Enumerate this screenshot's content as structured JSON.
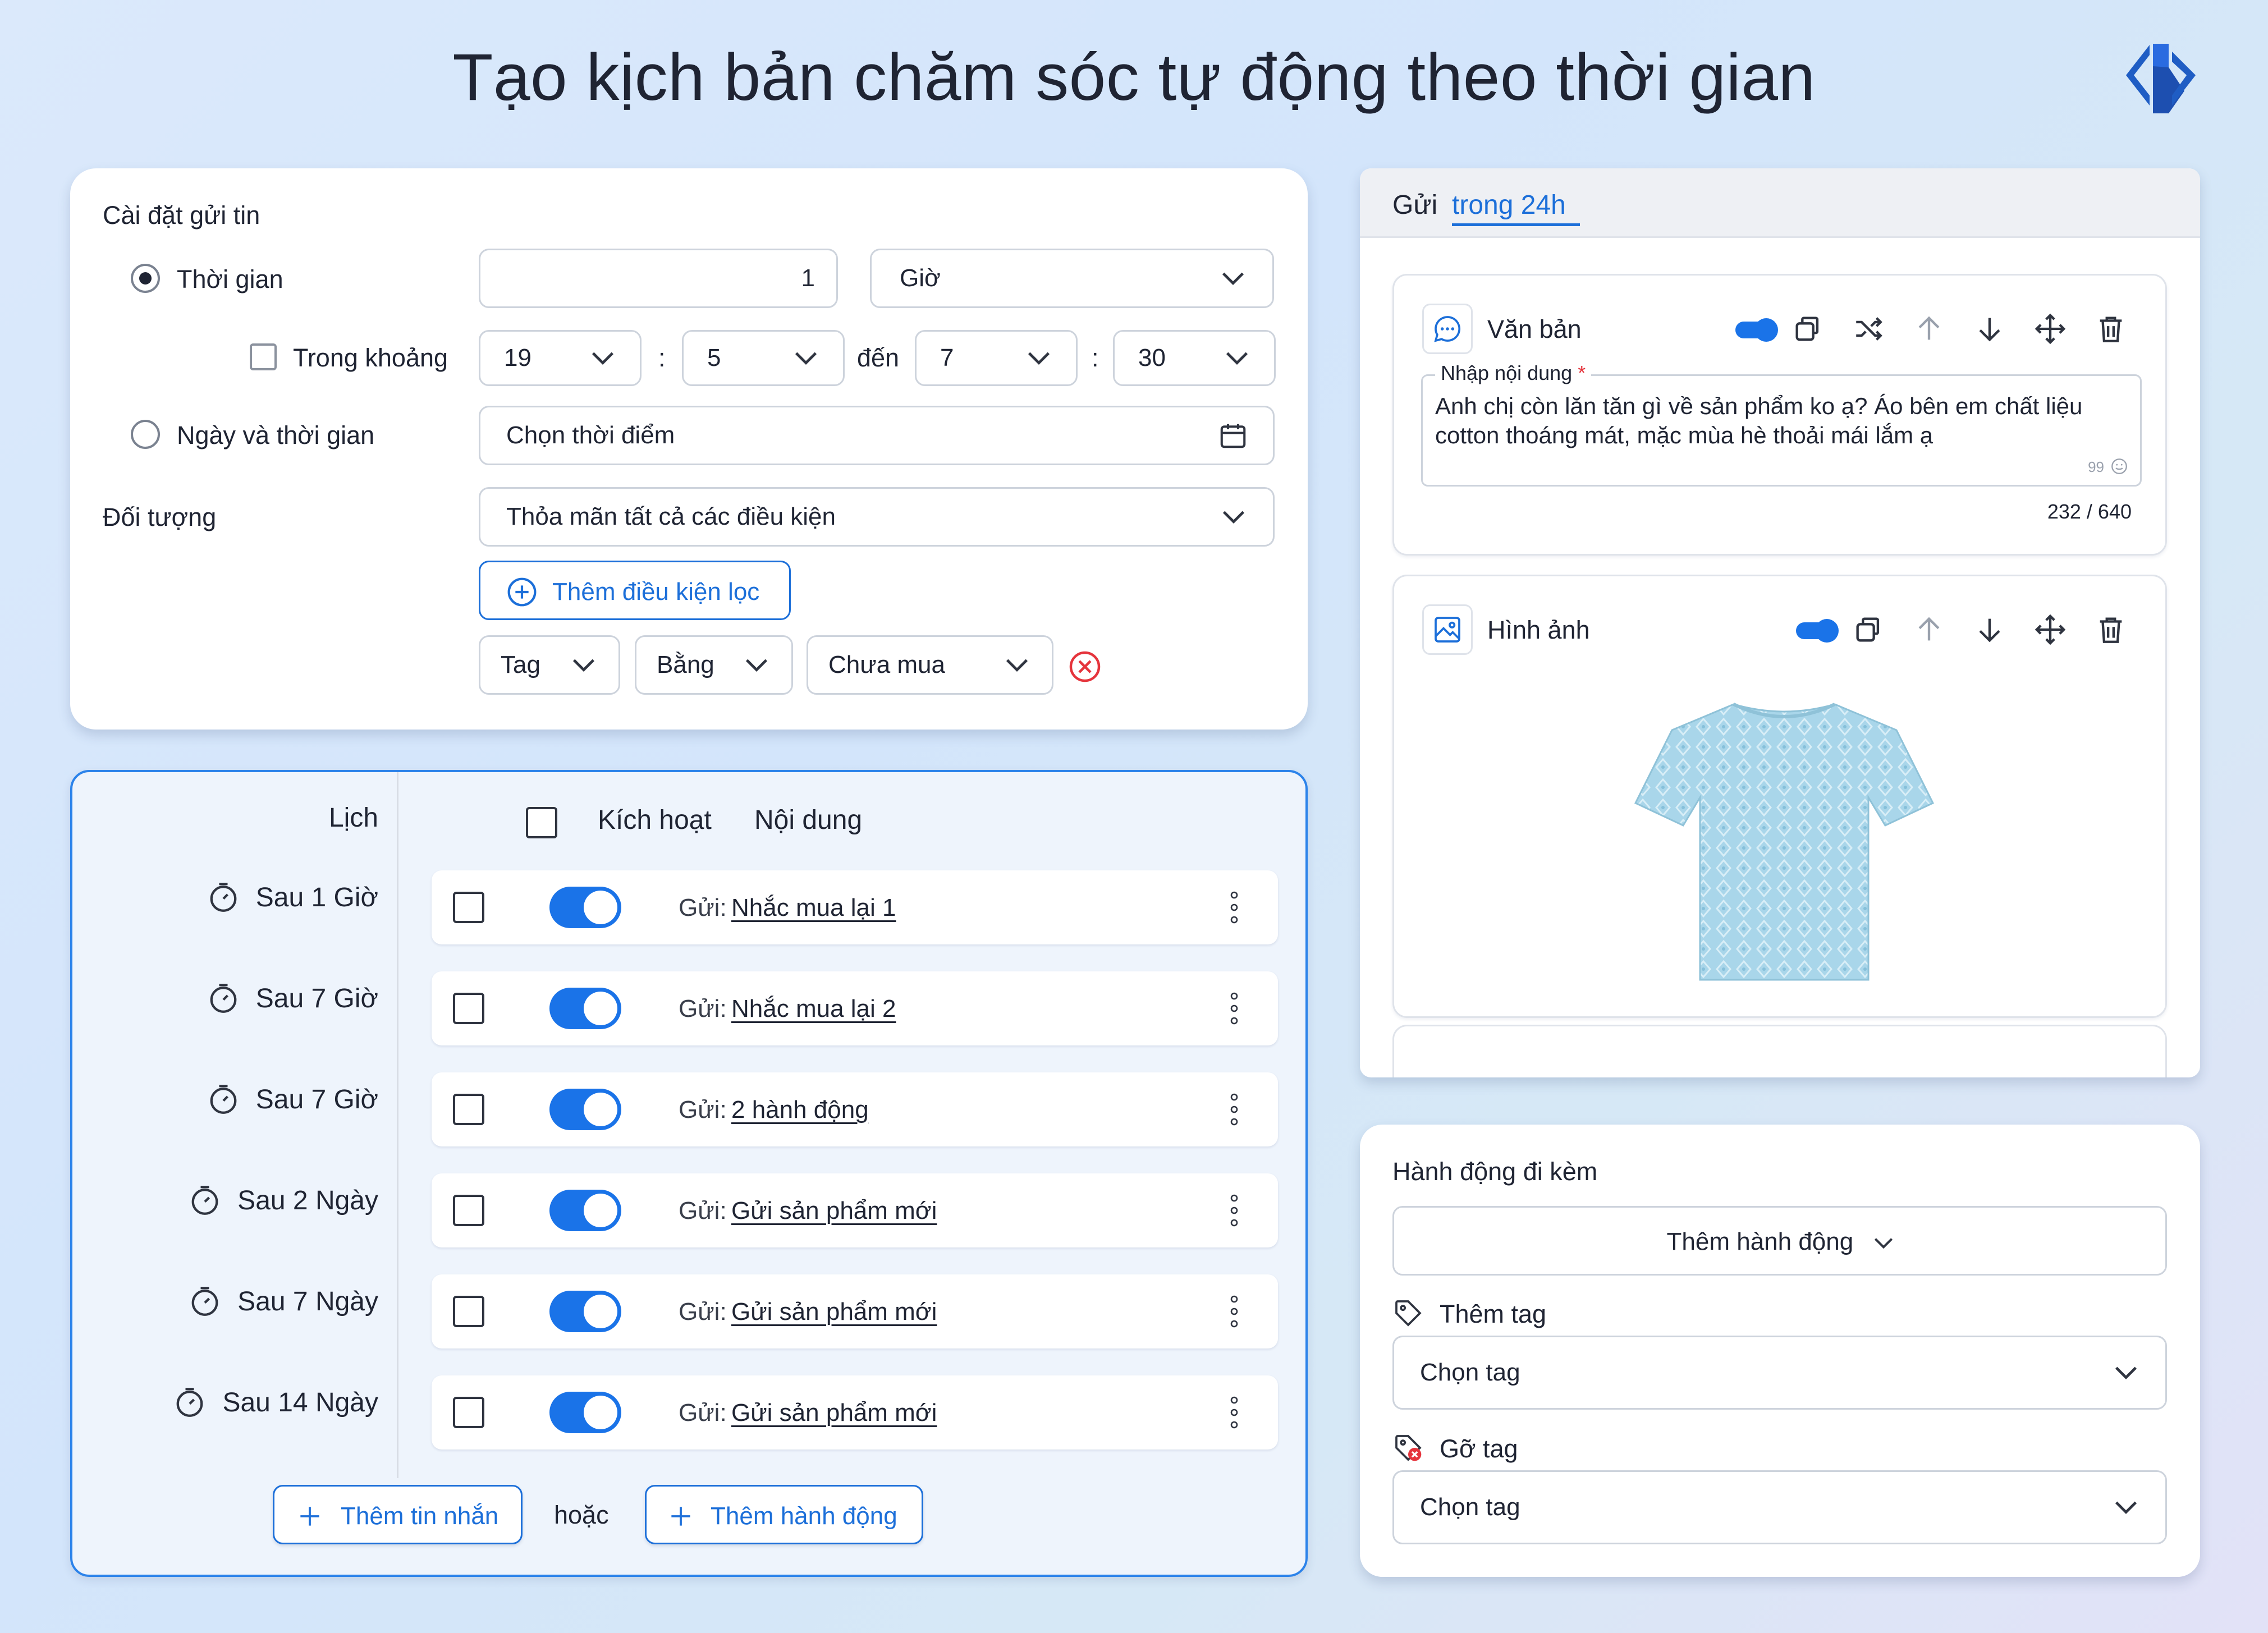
{
  "title": "Tạo kịch bản chăm sóc tự động theo thời gian",
  "settings": {
    "heading": "Cài đặt gửi tin",
    "time_label": "Thời gian",
    "time_value": "1",
    "time_unit": "Giờ",
    "range_label": "Trong khoảng",
    "range_from_hour": "19",
    "range_from_min": "5",
    "range_sep": ":",
    "range_to_label": "đến",
    "range_to_hour": "7",
    "range_to_min": "30",
    "datetime_label": "Ngày và thời gian",
    "datetime_placeholder": "Chọn thời điểm",
    "target_label": "Đối tượng",
    "target_value": "Thỏa mãn tất cả các điều kiện",
    "add_filter_label": "Thêm điều kiện lọc",
    "filter_field": "Tag",
    "filter_op": "Bằng",
    "filter_value": "Chưa mua"
  },
  "schedule": {
    "col_schedule": "Lịch",
    "col_active": "Kích hoạt",
    "col_content": "Nội dung",
    "send_prefix": "Gửi:",
    "rows": [
      {
        "delay": "Sau 1 Giờ",
        "content": "Nhắc mua lại 1"
      },
      {
        "delay": "Sau 7 Giờ",
        "content": "Nhắc mua lại 2"
      },
      {
        "delay": "Sau 7 Giờ",
        "content": "2 hành động"
      },
      {
        "delay": "Sau 2 Ngày",
        "content": "Gửi sản phẩm mới"
      },
      {
        "delay": "Sau 7 Ngày",
        "content": "Gửi sản phẩm mới"
      },
      {
        "delay": "Sau 14 Ngày",
        "content": "Gửi sản phẩm mới"
      }
    ],
    "add_message_label": "Thêm tin nhắn",
    "or_label": "hoặc",
    "add_action_label": "Thêm hành động"
  },
  "message": {
    "header_prefix": "Gửi",
    "header_link": "trong 24h",
    "text_block_label": "Văn bản",
    "input_label": "Nhập nội dung",
    "required_mark": "*",
    "input_text": "Anh chị còn lăn tăn gì về sản phẩm ko ạ? Áo bên em chất liệu cotton thoáng mát, mặc mùa hè thoải mái lắm ạ",
    "quote_mark": "99",
    "char_count": "232 / 640",
    "image_block_label": "Hình ảnh"
  },
  "actions": {
    "heading": "Hành động đi kèm",
    "add_action_dropdown": "Thêm hành động",
    "add_tag_label": "Thêm tag",
    "add_tag_placeholder": "Chọn tag",
    "remove_tag_label": "Gỡ tag",
    "remove_tag_placeholder": "Chọn tag"
  },
  "colors": {
    "accent": "#1a73e8",
    "danger": "#e5343c",
    "text": "#1f2433"
  }
}
